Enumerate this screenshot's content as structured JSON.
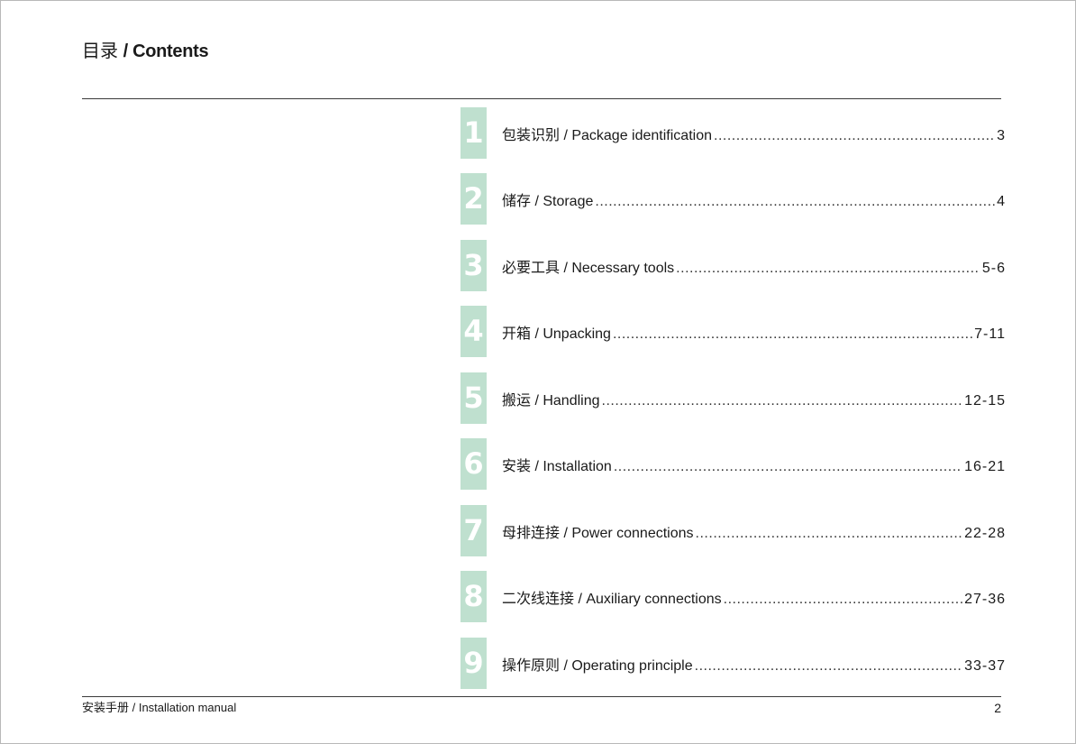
{
  "header": {
    "title_zh": "目录",
    "title_en": "/ Contents"
  },
  "accent_color": "#bfe0cf",
  "toc": [
    {
      "number": "1",
      "label": "包装识别 / Package identification",
      "pages": "3"
    },
    {
      "number": "2",
      "label": "储存 / Storage",
      "pages": "4"
    },
    {
      "number": "3",
      "label": "必要工具 / Necessary tools",
      "pages": "5-6"
    },
    {
      "number": "4",
      "label": "开箱 / Unpacking",
      "pages": "7-11"
    },
    {
      "number": "5",
      "label": "搬运 / Handling",
      "pages": "12-15"
    },
    {
      "number": "6",
      "label": "安装 / Installation",
      "pages": "16-21"
    },
    {
      "number": "7",
      "label": "母排连接 / Power connections",
      "pages": "22-28"
    },
    {
      "number": "8",
      "label": "二次线连接 / Auxiliary connections",
      "pages": "27-36"
    },
    {
      "number": "9",
      "label": "操作原则 / Operating principle",
      "pages": "33-37"
    }
  ],
  "footer": {
    "manual_title": "安装手册 / Installation manual",
    "page_number": "2"
  }
}
